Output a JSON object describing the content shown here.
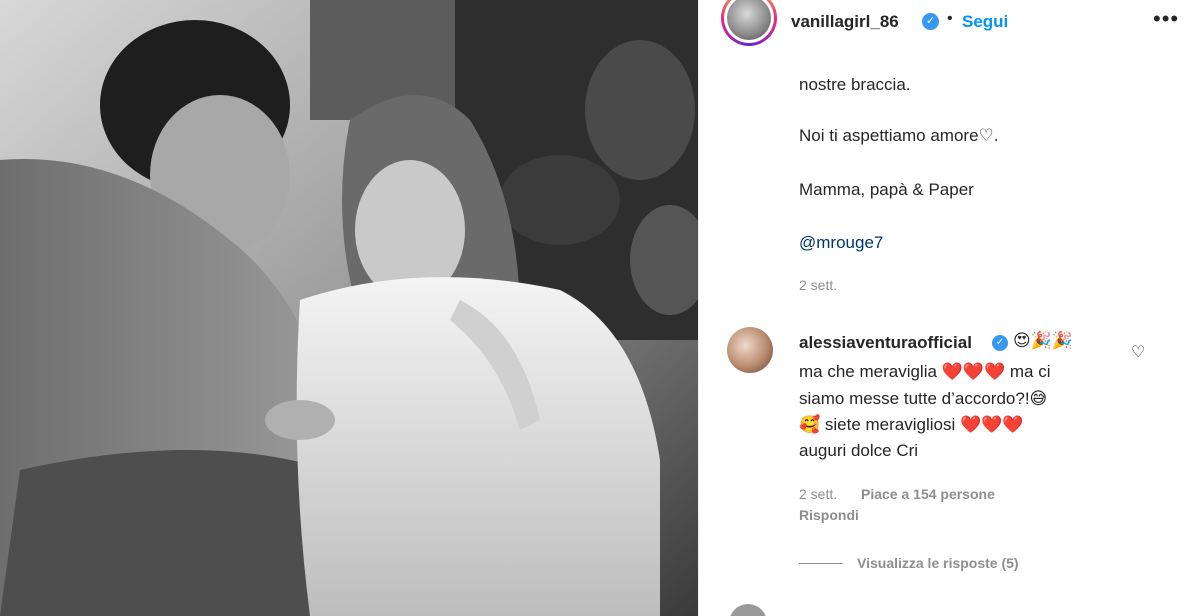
{
  "post": {
    "username": "vanillagirl_86",
    "verified_glyph": "✓",
    "separator": "•",
    "follow_label": "Segui",
    "more_glyph": "•••",
    "avatar_icon": "profile-photo",
    "caption": [
      "nostre braccia.",
      "Noi ti aspettiamo amore♡.",
      "Mamma, papà & Paper"
    ],
    "mention": "@mrouge7",
    "time": "2 sett."
  },
  "comment": {
    "username": "alessiaventuraofficial",
    "verified_glyph": "✓",
    "header_emojis": "😍🎉🎉",
    "lines": [
      "ma che meraviglia ❤️❤️❤️ ma ci",
      "siamo messe tutte d’accordo?!😅",
      "🥰 siete meravigliosi ❤️❤️❤️",
      "auguri dolce Cri"
    ],
    "time": "2 sett.",
    "likes": "Piace a 154 persone",
    "reply_label": "Rispondi",
    "like_icon": "heart-outline-icon",
    "like_glyph": "♡",
    "view_replies": "Visualizza le risposte (5)"
  },
  "colors": {
    "link": "#0095f6",
    "mention": "#00376b",
    "muted": "#8e8e8e",
    "verified": "#3897f0"
  }
}
